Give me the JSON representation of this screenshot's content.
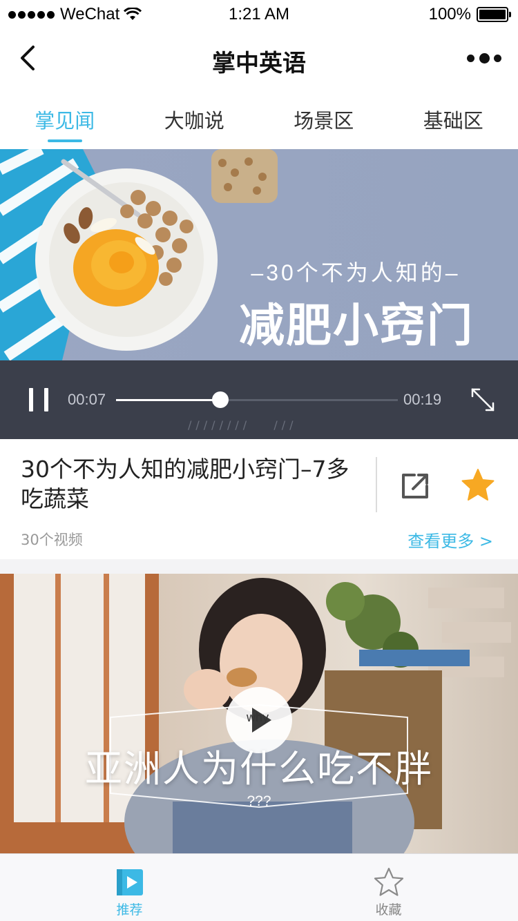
{
  "status_bar": {
    "carrier": "WeChat",
    "time": "1:21 AM",
    "battery": "100%",
    "battery_level": 1.0
  },
  "nav": {
    "title": "掌中英语",
    "back_icon": "chevron-left-icon",
    "more_icon": "more-dots-icon"
  },
  "tabs": [
    {
      "label": "掌见闻",
      "active": true
    },
    {
      "label": "大咖说",
      "active": false
    },
    {
      "label": "场景区",
      "active": false
    },
    {
      "label": "基础区",
      "active": false
    }
  ],
  "banner": {
    "subtitle": "–30个不为人知的–",
    "title": "减肥小窍门"
  },
  "player": {
    "current_time": "00:07",
    "total_time": "00:19",
    "progress": 0.37,
    "pause_icon": "pause-icon",
    "fullscreen_icon": "fullscreen-icon"
  },
  "info": {
    "title": "30个不为人知的减肥小窍门–7多吃蔬菜",
    "count": "30个视频",
    "more_link": "查看更多 >",
    "share_icon": "share-icon",
    "favorite_icon": "star-icon",
    "favorited": true
  },
  "video": {
    "title": "亚洲人为什么吃不胖",
    "subtitle": "???",
    "badge": "why",
    "play_icon": "play-icon"
  },
  "tabbar": [
    {
      "label": "推荐",
      "icon": "video-play-icon",
      "active": true
    },
    {
      "label": "收藏",
      "icon": "star-outline-icon",
      "active": false
    }
  ],
  "colors": {
    "accent": "#3cb9e5",
    "star": "#f7a823",
    "player_bg": "#3b3f4b",
    "banner_bg": "#9aa6c2"
  }
}
